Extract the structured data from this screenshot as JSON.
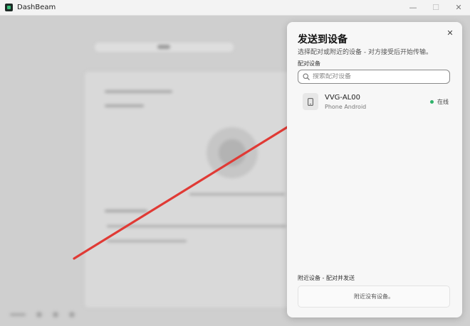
{
  "window": {
    "title": "DashBeam",
    "controls": {
      "minimize": "—",
      "maximize": "☐",
      "close": "✕"
    }
  },
  "dialog": {
    "title": "发送到设备",
    "subtitle": "选择配对或附近的设备 - 对方接受后开始传输。",
    "close_glyph": "✕",
    "paired_section": {
      "label": "配对设备",
      "search_placeholder": "搜索配对设备",
      "search_value": "",
      "devices": [
        {
          "name": "VVG-AL00",
          "type": "Phone Android",
          "status": "在线",
          "icon": "phone-icon"
        }
      ]
    },
    "nearby_section": {
      "label": "附近设备 - 配对并发送",
      "empty_text": "附近没有设备。"
    }
  },
  "colors": {
    "online": "#2fb36b",
    "arrow": "#e03a35",
    "dialog_bg": "#f7f7f7"
  }
}
